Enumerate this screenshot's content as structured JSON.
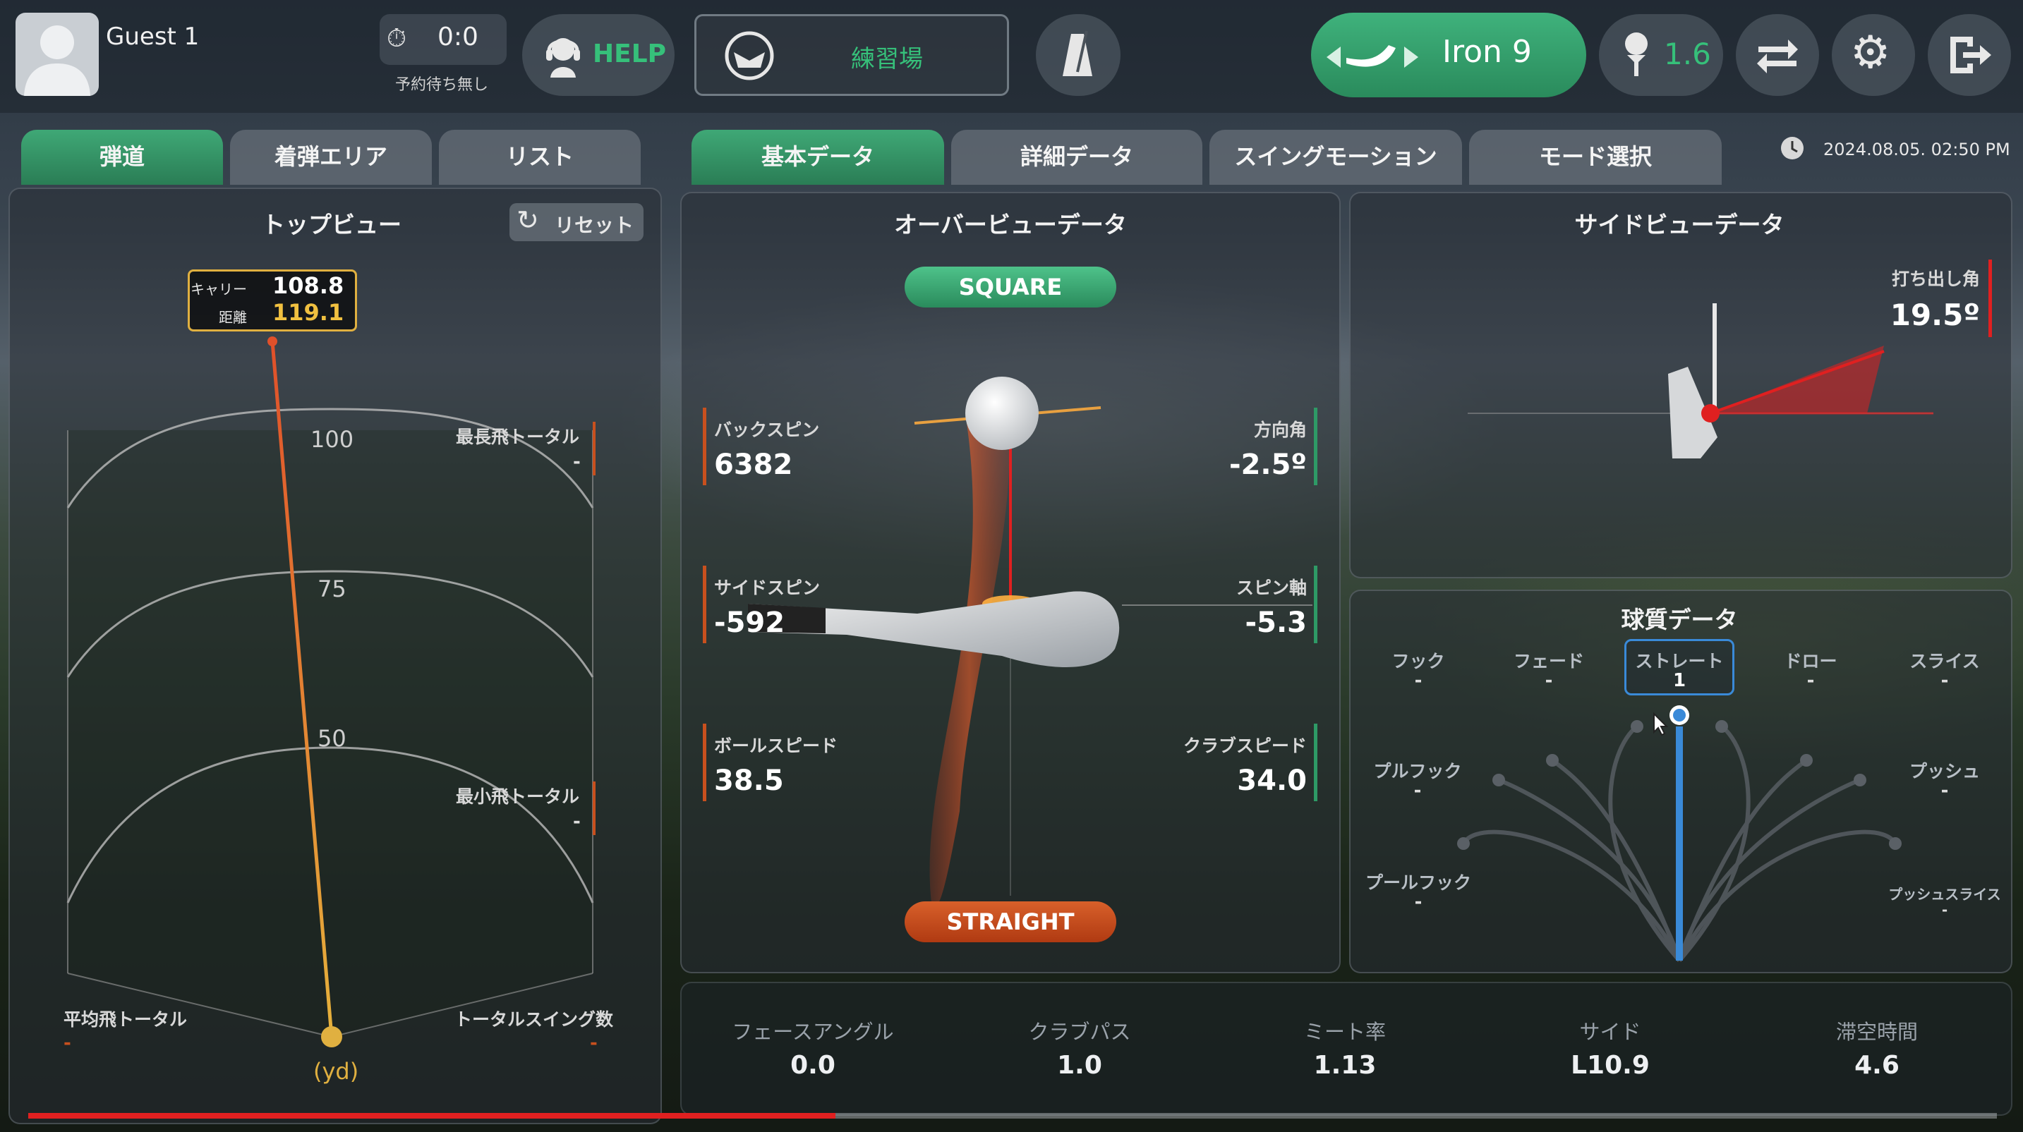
{
  "header": {
    "user": "Guest 1",
    "timer": "0:0",
    "reservation": "予約待ち無し",
    "help": "HELP",
    "mode": "練習場",
    "club": "Iron 9",
    "tee_height": "1.6"
  },
  "left_tabs": [
    "弾道",
    "着弾エリア",
    "リスト"
  ],
  "main_tabs": [
    "基本データ",
    "詳細データ",
    "スイングモーション",
    "モード選択"
  ],
  "datetime": "2024.08.05. 02:50 PM",
  "topview": {
    "title": "トップビュー",
    "reset": "リセット",
    "carry_label": "キャリー",
    "carry": "108.8",
    "distance_label": "距離",
    "distance": "119.1",
    "ring_100": "100",
    "ring_75": "75",
    "ring_50": "50",
    "max_label": "最長飛トータル",
    "max_value": "-",
    "min_label": "最小飛トータル",
    "min_value": "-",
    "avg_label": "平均飛トータル",
    "avg_value": "-",
    "total_label": "トータルスイング数",
    "total_value": "-",
    "unit": "(yd)"
  },
  "overview": {
    "title": "オーバービューデータ",
    "face": "SQUARE",
    "path": "STRAIGHT",
    "backspin_label": "バックスピン",
    "backspin": "6382",
    "sidespin_label": "サイドスピン",
    "sidespin": "-592",
    "ballspeed_label": "ボールスピード",
    "ballspeed": "38.5",
    "direction_label": "方向角",
    "direction": "-2.5º",
    "spinaxis_label": "スピン軸",
    "spinaxis": "-5.3",
    "clubspeed_label": "クラブスピード",
    "clubspeed": "34.0"
  },
  "sideview": {
    "title": "サイドビューデータ",
    "launch_label": "打ち出し角",
    "launch": "19.5º"
  },
  "ballflight": {
    "title": "球質データ",
    "hook": "フック",
    "hook_v": "-",
    "fade": "フェード",
    "fade_v": "-",
    "straight": "ストレート",
    "straight_v": "1",
    "draw": "ドロー",
    "draw_v": "-",
    "slice": "スライス",
    "slice_v": "-",
    "pullhook": "プルフック",
    "pullhook_v": "-",
    "push": "プッシュ",
    "push_v": "-",
    "pullhook2": "プールフック",
    "pullhook2_v": "-",
    "pushslice": "プッシュスライス",
    "pushslice_v": "-"
  },
  "bottom": [
    {
      "label": "フェースアングル",
      "value": "0.0"
    },
    {
      "label": "クラブパス",
      "value": "1.0"
    },
    {
      "label": "ミート率",
      "value": "1.13"
    },
    {
      "label": "サイド",
      "value": "L10.9"
    },
    {
      "label": "滞空時間",
      "value": "4.6"
    }
  ],
  "progress": 0.41,
  "colors": {
    "accent": "#2e9a66",
    "orange": "#c8501e",
    "blue": "#3a8ad8",
    "red": "#e0201e"
  }
}
